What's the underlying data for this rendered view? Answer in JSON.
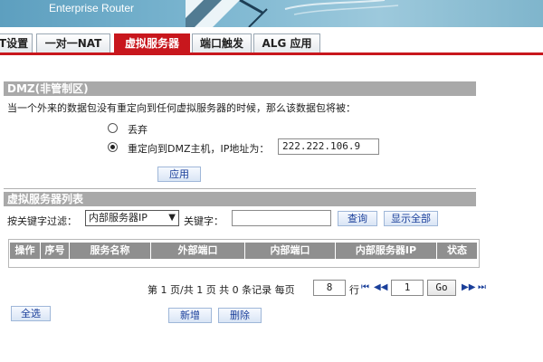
{
  "header": {
    "brand": "Enterprise Router"
  },
  "tabs": [
    {
      "label": "T设置"
    },
    {
      "label": "一对一NAT"
    },
    {
      "label": "虚拟服务器"
    },
    {
      "label": "端口触发"
    },
    {
      "label": "ALG 应用"
    }
  ],
  "dmz": {
    "title": "DMZ(非管制区)",
    "description": "当一个外来的数据包没有重定向到任何虚拟服务器的时候，那么该数据包将被：",
    "option_drop": "丢弃",
    "option_redirect": "重定向到DMZ主机，IP地址为：",
    "ip_value": "222.222.106.9",
    "apply_label": "应用"
  },
  "vserver": {
    "title": "虚拟服务器列表",
    "filter_label": "按关键字过滤：",
    "filter_select": "内部服务器IP",
    "keyword_label": "关键字：",
    "keyword_value": "",
    "query_label": "查询",
    "show_all_label": "显示全部",
    "columns": [
      "操作",
      "序号",
      "服务名称",
      "外部端口",
      "内部端口",
      "内部服务器IP",
      "状态"
    ]
  },
  "pager": {
    "text_prefix": "第 1 页/共 1 页 共 0 条记录 每页",
    "per_page": "8",
    "row_unit": "行",
    "page_value": "1",
    "go_label": "Go",
    "first_glyph": "⏮",
    "prev_glyph": "◀◀",
    "next_glyph": "▶▶",
    "last_glyph": "⏭"
  },
  "actions": {
    "select_all_label": "全选",
    "add_label": "新增",
    "delete_label": "删除"
  }
}
